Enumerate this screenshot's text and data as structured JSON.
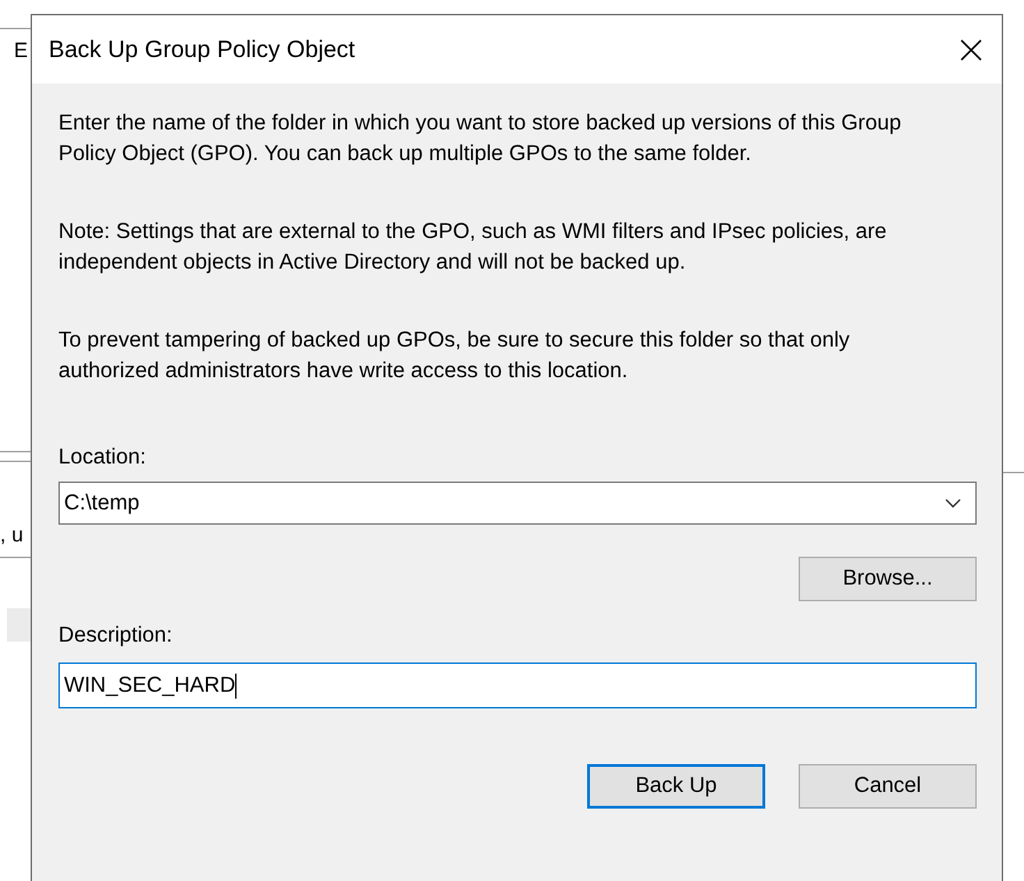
{
  "background_window": {
    "fragments": [
      "E",
      ", u"
    ]
  },
  "dialog": {
    "title": "Back Up Group Policy Object",
    "paragraphs": [
      "Enter the name of the folder in which you want to store backed up versions of this Group Policy Object (GPO). You can back up multiple GPOs to the same folder.",
      "Note: Settings that are external to the GPO, such as WMI filters and IPsec policies, are independent objects in Active Directory and will not be backed up.",
      "To prevent tampering of backed up GPOs, be sure to secure this folder so that only authorized administrators have write access to this location."
    ],
    "location": {
      "label": "Location:",
      "value": "C:\\temp"
    },
    "browse_button": "Browse...",
    "description": {
      "label": "Description:",
      "value": "WIN_SEC_HARD",
      "focused": true
    },
    "buttons": [
      {
        "label": "Back Up",
        "default": true
      },
      {
        "label": "Cancel",
        "default": false
      }
    ]
  }
}
